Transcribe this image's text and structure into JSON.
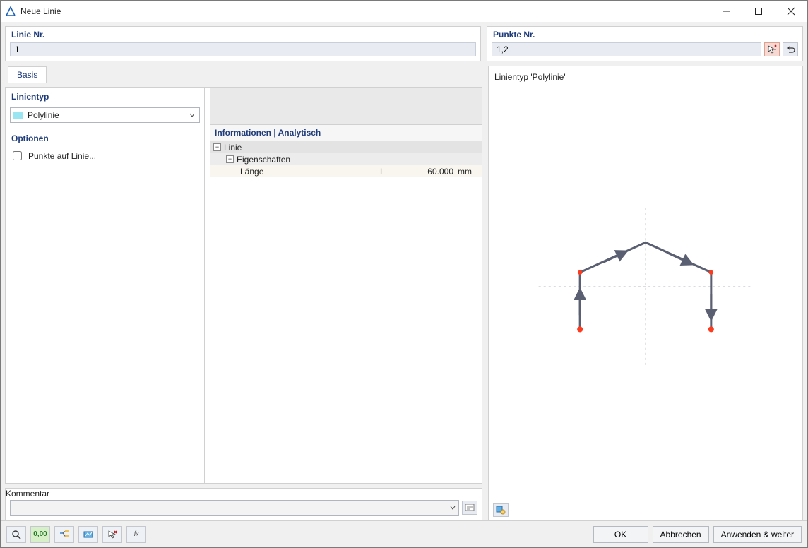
{
  "window": {
    "title": "Neue Linie"
  },
  "top": {
    "linie_label": "Linie Nr.",
    "linie_value": "1",
    "punkte_label": "Punkte Nr.",
    "punkte_value": "1,2"
  },
  "tabs": {
    "basis": "Basis"
  },
  "sections": {
    "linientyp_hdr": "Linientyp",
    "linientyp_value": "Polylinie",
    "optionen_hdr": "Optionen",
    "opt_punkte": "Punkte auf Linie...",
    "info_hdr": "Informationen | Analytisch",
    "tree": {
      "linie": "Linie",
      "eigenschaften": "Eigenschaften",
      "laenge_name": "Länge",
      "laenge_sym": "L",
      "laenge_val": "60.000",
      "laenge_unit": "mm"
    },
    "kommentar_hdr": "Kommentar"
  },
  "preview": {
    "title": "Linientyp 'Polylinie'"
  },
  "icons": {
    "pick": "pick-cursor",
    "loop": "loop-arrow",
    "comment_btn": "insert-comment",
    "preview_tool": "view-settings"
  },
  "footer": {
    "tools": [
      "help",
      "units",
      "tree-opt",
      "display",
      "delete-pick",
      "fx"
    ],
    "ok": "OK",
    "cancel": "Abbrechen",
    "apply": "Anwenden & weiter"
  }
}
